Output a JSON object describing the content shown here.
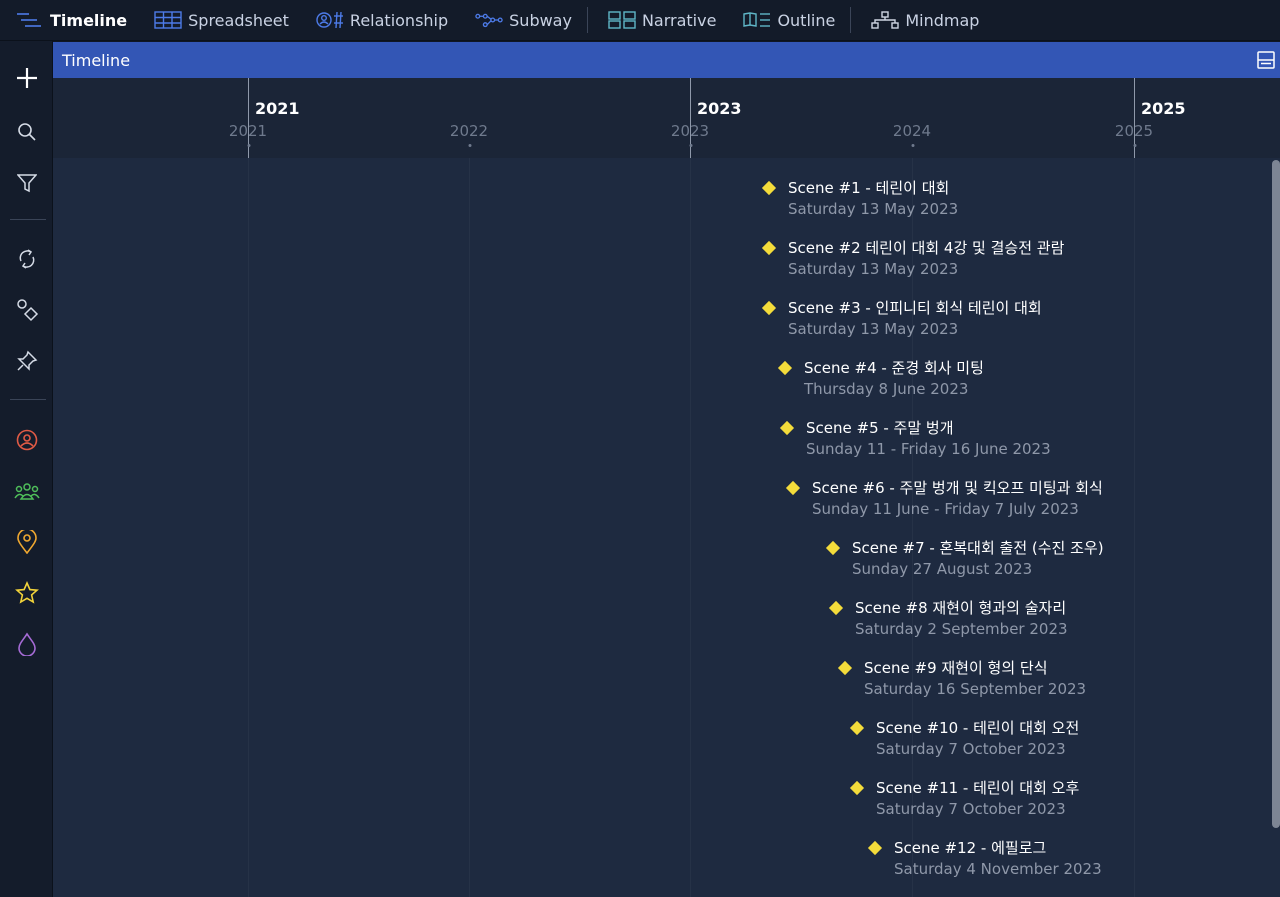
{
  "toolbar": {
    "items": [
      {
        "label": "Timeline",
        "icon": "timeline-icon"
      },
      {
        "label": "Spreadsheet",
        "icon": "spreadsheet-icon"
      },
      {
        "label": "Relationship",
        "icon": "relationship-icon"
      },
      {
        "label": "Subway",
        "icon": "subway-icon"
      },
      {
        "label": "Narrative",
        "icon": "narrative-icon"
      },
      {
        "label": "Outline",
        "icon": "outline-icon"
      },
      {
        "label": "Mindmap",
        "icon": "mindmap-icon"
      }
    ],
    "active": "Timeline"
  },
  "rail": {
    "colors": {
      "character": "#e05a45",
      "group": "#4fbf5a",
      "place": "#f0a830",
      "star": "#f2d33a",
      "drop": "#a66bd6"
    }
  },
  "panel": {
    "title": "Timeline"
  },
  "axis": {
    "major": [
      "2021",
      "2023",
      "2025"
    ],
    "minor": [
      "2021",
      "2022",
      "2023",
      "2024",
      "2025"
    ]
  },
  "colors": {
    "accent": "#3356b5",
    "event_marker": "#f4dc3b"
  },
  "events": [
    {
      "title": "Scene #1 - 테린이 대회",
      "date": "Saturday 13 May 2023"
    },
    {
      "title": "Scene #2 테린이 대회 4강 및 결승전 관람",
      "date": "Saturday 13 May 2023"
    },
    {
      "title": "Scene #3 - 인피니티 회식 테린이 대회",
      "date": "Saturday 13 May 2023"
    },
    {
      "title": "Scene #4 - 준경 회사 미팅",
      "date": "Thursday 8 June 2023"
    },
    {
      "title": "Scene #5 - 주말 벙개",
      "date": "Sunday 11 - Friday 16 June 2023"
    },
    {
      "title": "Scene #6 - 주말 벙개 및 킥오프 미팅과 회식",
      "date": "Sunday 11 June - Friday 7 July 2023"
    },
    {
      "title": "Scene #7 - 혼복대회 출전 (수진 조우)",
      "date": "Sunday 27 August 2023"
    },
    {
      "title": "Scene #8 재현이 형과의 술자리",
      "date": "Saturday 2 September 2023"
    },
    {
      "title": "Scene #9 재현이 형의 단식",
      "date": "Saturday 16 September 2023"
    },
    {
      "title": "Scene #10 - 테린이 대회 오전",
      "date": "Saturday 7 October 2023"
    },
    {
      "title": "Scene #11 - 테린이 대회 오후",
      "date": "Saturday 7 October 2023"
    },
    {
      "title": "Scene #12 - 에필로그",
      "date": "Saturday 4 November 2023"
    }
  ]
}
